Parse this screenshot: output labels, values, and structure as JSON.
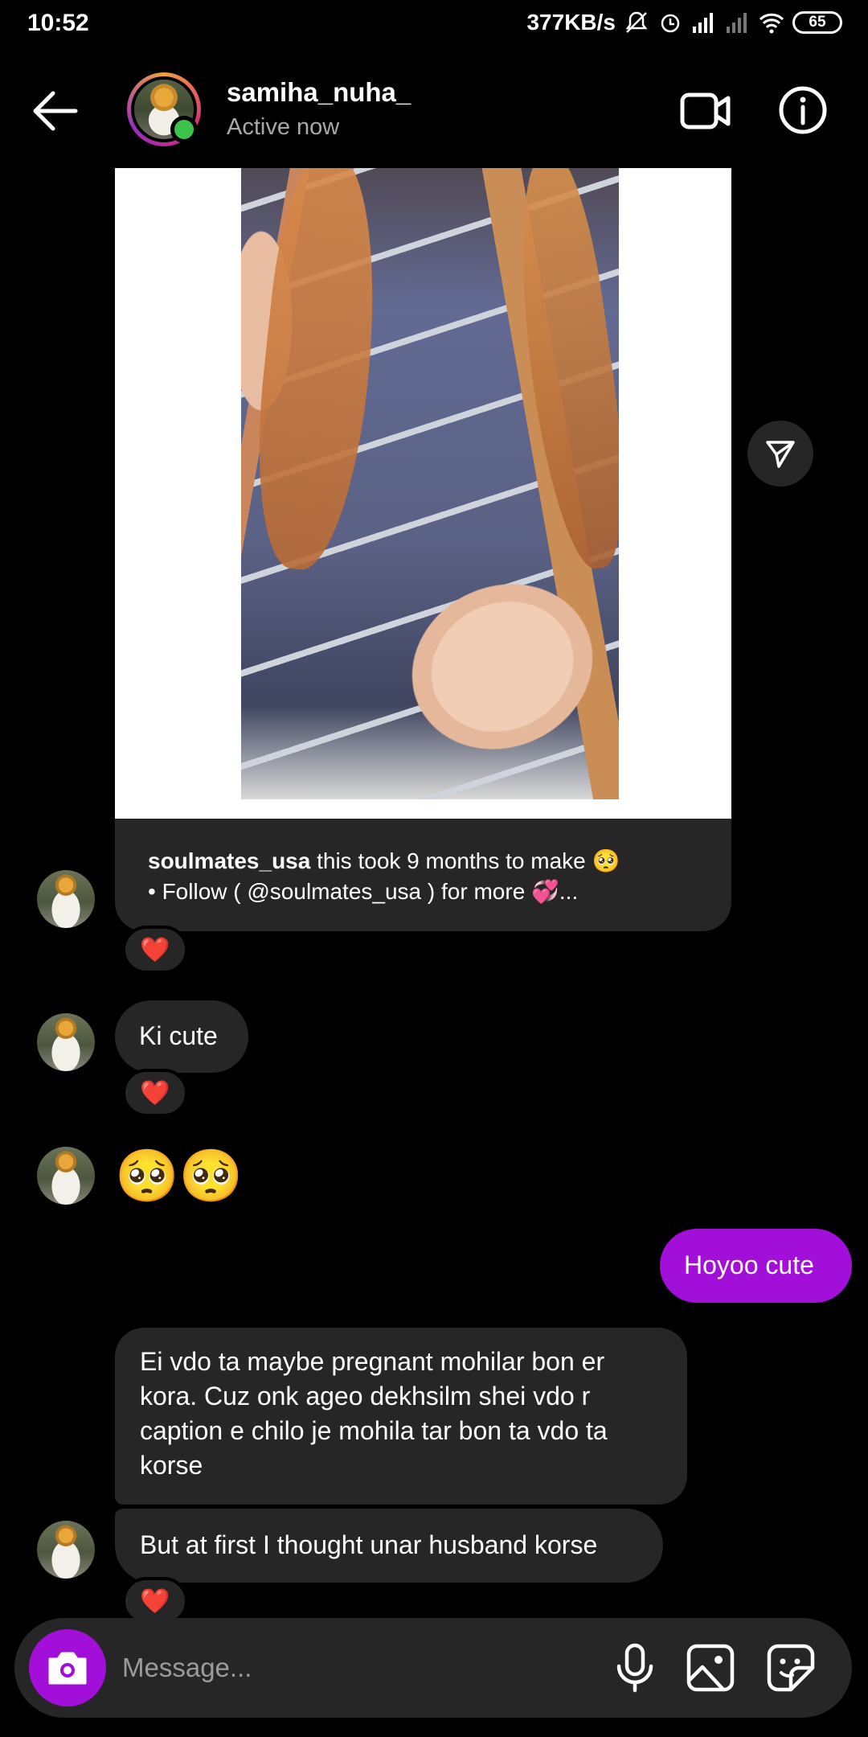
{
  "status_bar": {
    "time": "10:52",
    "network_speed": "377KB/s",
    "battery": "65"
  },
  "header": {
    "username": "samiha_nuha_",
    "status": "Active now"
  },
  "shared_post": {
    "username": "soulmates_usa",
    "caption_line1": "this took 9 months to make 🥺",
    "caption_line2": "• Follow ( @soulmates_usa ) for more 💞..."
  },
  "messages": {
    "reaction_emoji": "❤️",
    "ki_cute": "Ki cute",
    "emoji_msg": "🥺🥺",
    "hoyoo_cute": "Hoyoo cute",
    "long_msg": "Ei vdo ta maybe pregnant mohilar bon er kora. Cuz onk ageo dekhsilm shei vdo r caption e chilo je mohila tar bon ta vdo ta korse",
    "husband_msg": "But at first I thought unar husband korse"
  },
  "input": {
    "placeholder": "Message..."
  },
  "colors": {
    "accent": "#a20fd8",
    "bubble": "#262626",
    "online": "#3cc34b",
    "heart": "#ed2f3a"
  },
  "icons": [
    "arrow-left-icon",
    "video-camera-icon",
    "info-icon",
    "send-icon",
    "camera-icon",
    "microphone-icon",
    "gallery-icon",
    "sticker-icon"
  ]
}
